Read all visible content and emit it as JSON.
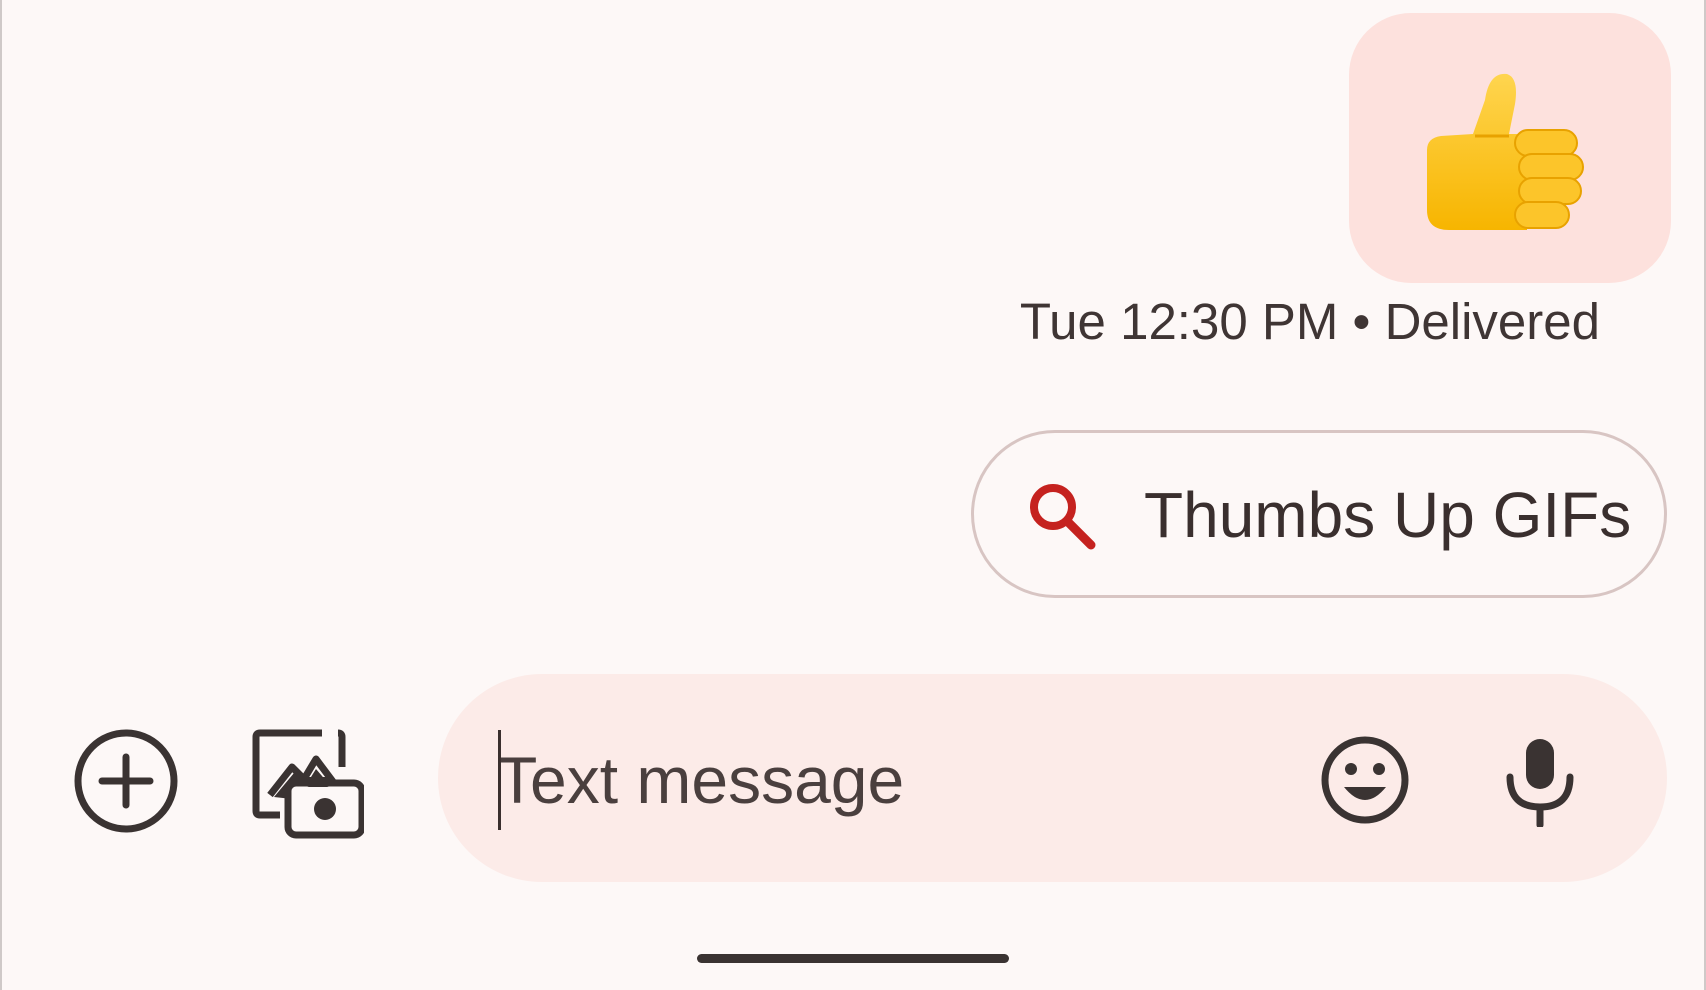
{
  "conversation": {
    "last_message": {
      "emoji": "👍",
      "emoji_icon": "thumbs-up-emoji",
      "bubble_color": "#fde1dd",
      "timestamp": "Tue 12:30 PM",
      "separator": "•",
      "status": "Delivered",
      "meta_text": "Tue 12:30 PM • Delivered"
    },
    "suggestion_chip": {
      "label": "Thumbs Up GIFs",
      "icon": "search-icon",
      "icon_color": "#c5221f"
    }
  },
  "composer": {
    "placeholder": "Text message",
    "value": "",
    "left_buttons": [
      {
        "name": "add-attachment",
        "icon": "add-circle-icon"
      },
      {
        "name": "gallery-camera",
        "icon": "photo-camera-icon"
      }
    ],
    "right_buttons": [
      {
        "name": "emoji",
        "icon": "emoji-smile-icon"
      },
      {
        "name": "voice",
        "icon": "microphone-icon"
      }
    ],
    "background_color": "#fcebe8"
  },
  "system": {
    "home_indicator": "gesture-bar"
  }
}
